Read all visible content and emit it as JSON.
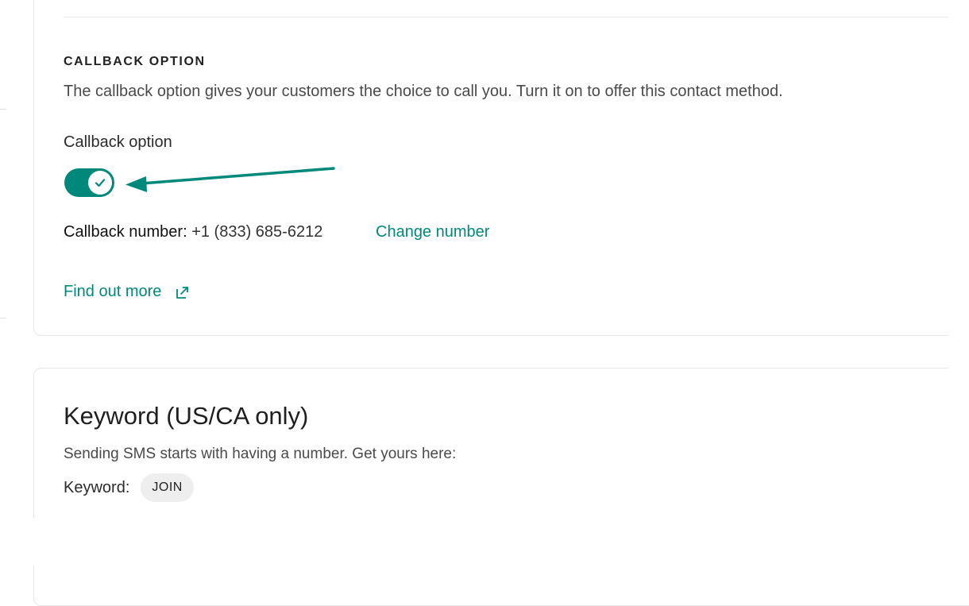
{
  "callback_section": {
    "heading": "CALLBACK OPTION",
    "description": "The callback option gives your customers the choice to call you. Turn it on to offer this contact method.",
    "toggle_label": "Callback option",
    "toggle_state": "on",
    "number_label": "Callback number:",
    "number_value": "+1 (833) 685-6212",
    "change_number_link": "Change number",
    "find_out_more_link": "Find out more",
    "external_link_icon": "external-link-icon",
    "check_icon": "check-icon"
  },
  "keyword_section": {
    "title": "Keyword (US/CA only)",
    "description": "Sending SMS starts with having a number. Get yours here:",
    "keyword_label": "Keyword:",
    "keyword_value": "JOIN"
  },
  "colors": {
    "accent": "#00897b",
    "annotation_arrow": "#00897b",
    "chip_background": "#eeeeee"
  }
}
